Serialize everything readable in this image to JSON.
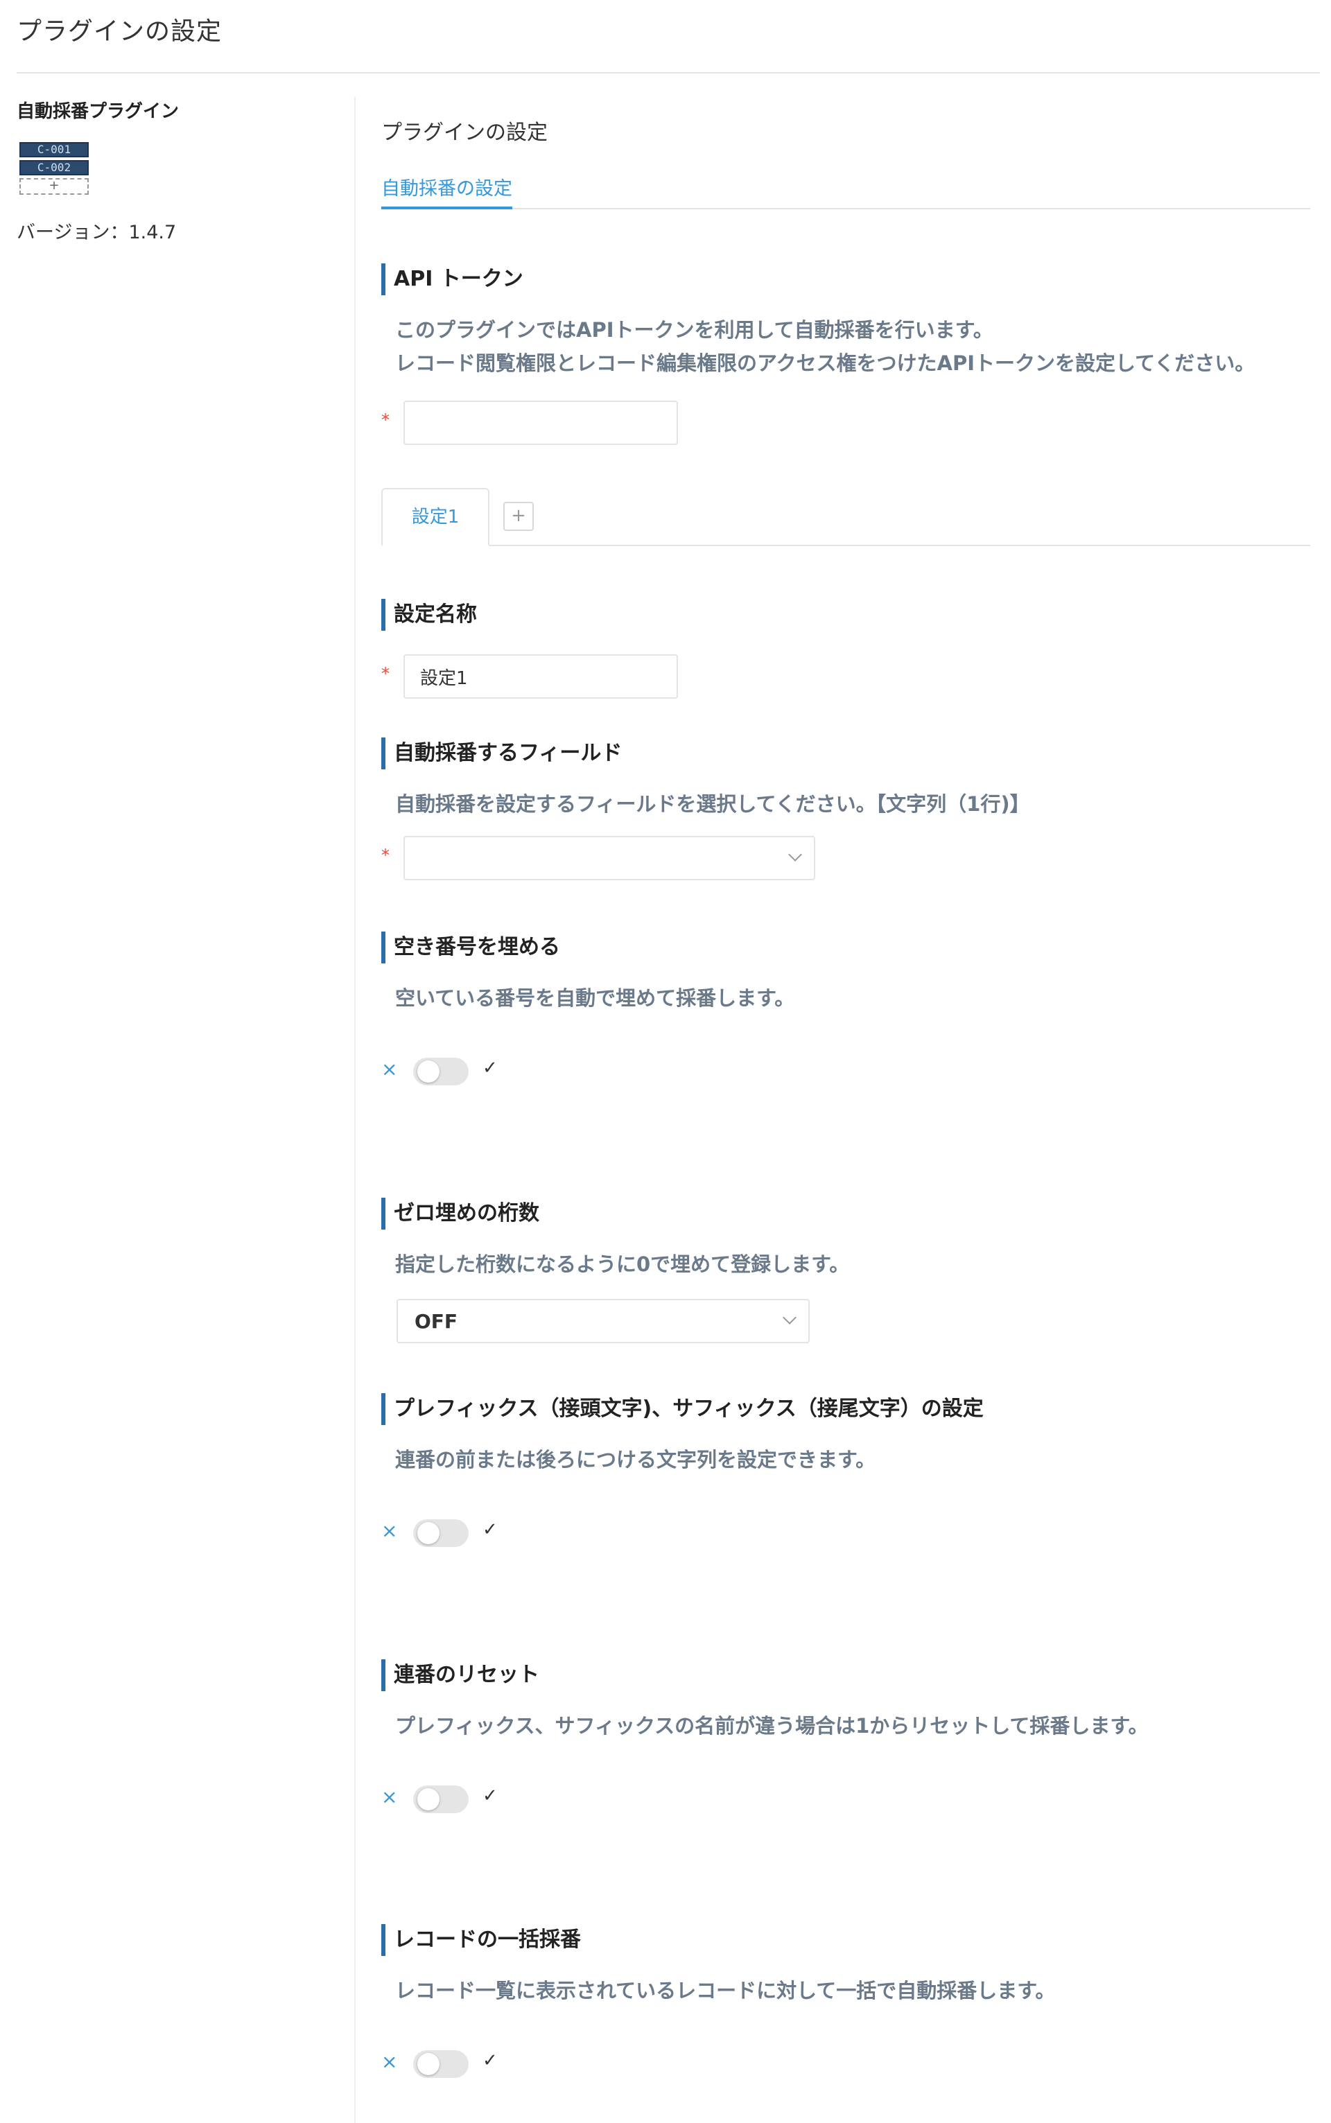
{
  "page": {
    "title": "プラグインの設定"
  },
  "sidebar": {
    "plugin_name": "自動採番プラグイン",
    "logo": {
      "box1": "C-001",
      "box2": "C-002",
      "add": "+"
    },
    "version": "バージョン：1.4.7"
  },
  "main": {
    "title": "プラグインの設定",
    "tab_label": "自動採番の設定"
  },
  "api_token": {
    "title": "API トークン",
    "desc_line1": "このプラグインではAPIトークンを利用して自動採番を行います。",
    "desc_line2": "レコード閲覧権限とレコード編集権限のアクセス権をつけたAPIトークンを設定してください。",
    "value": "",
    "required_mark": "*"
  },
  "settings_tabs": {
    "tabs": [
      {
        "label": "設定1"
      }
    ],
    "add_label": "+"
  },
  "setting_name": {
    "title": "設定名称",
    "value": "設定1",
    "required_mark": "*"
  },
  "target_field": {
    "title": "自動採番するフィールド",
    "desc": "自動採番を設定するフィールドを選択してください。【文字列（1行)】",
    "value": "",
    "required_mark": "*"
  },
  "fill_gaps": {
    "title": "空き番号を埋める",
    "desc": "空いている番号を自動で埋めて採番します。",
    "enabled": false
  },
  "zero_padding": {
    "title": "ゼロ埋めの桁数",
    "desc": "指定した桁数になるように0で埋めて登録します。",
    "value": "OFF"
  },
  "prefix_suffix": {
    "title": "プレフィックス（接頭文字)、サフィックス（接尾文字）の設定",
    "desc": "連番の前または後ろにつける文字列を設定できます。",
    "enabled": false
  },
  "reset": {
    "title": "連番のリセット",
    "desc": "プレフィックス、サフィックスの名前が違う場合は1からリセットして採番します。",
    "enabled": false
  },
  "bulk": {
    "title": "レコードの一括採番",
    "desc": "レコード一覧に表示されているレコードに対して一括で自動採番します。",
    "enabled": false
  },
  "toggle_symbols": {
    "off": "×",
    "on": "✓"
  },
  "colors": {
    "accent": "#3498db",
    "section_bar": "#2c6ea8",
    "required": "#e74c3c",
    "desc_text": "#6b7a8a"
  }
}
